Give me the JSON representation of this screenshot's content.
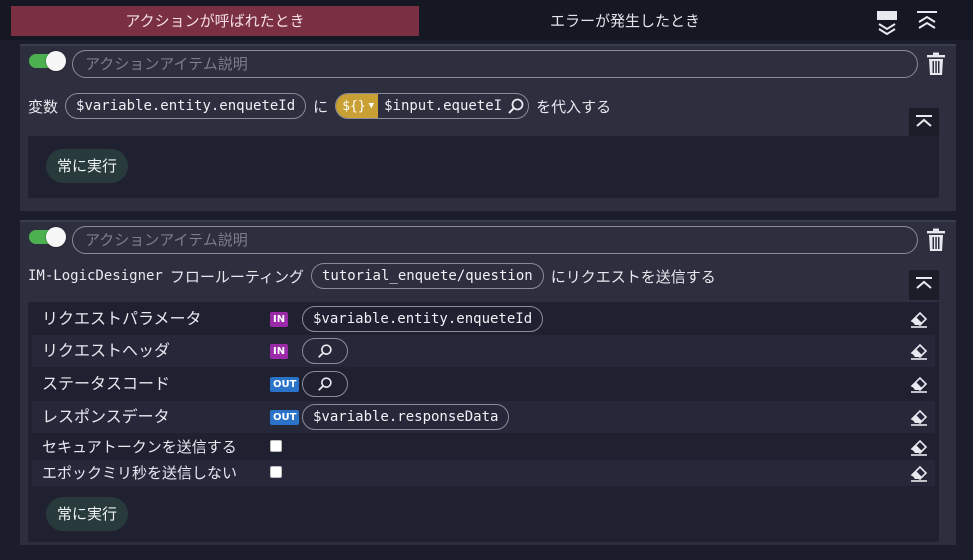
{
  "tabs": [
    {
      "label": "アクションが呼ばれたとき"
    },
    {
      "label": "エラーが発生したとき"
    }
  ],
  "action1": {
    "desc_placeholder": "アクションアイテム説明",
    "prefix": "変数",
    "variable": "$variable.entity.enqueteId",
    "particle": "に",
    "type_selector": "${}",
    "value": "$input.equeteI",
    "suffix": "を代入する",
    "run_label": "常に実行"
  },
  "action2": {
    "desc_placeholder": "アクションアイテム説明",
    "prefix": "IM-LogicDesigner",
    "routing_label": "フロールーティング",
    "flow": "tutorial_enquete/question",
    "suffix": "にリクエストを送信する",
    "params": [
      {
        "label": "リクエストパラメータ",
        "dir": "IN",
        "value": "$variable.entity.enqueteId"
      },
      {
        "label": "リクエストヘッダ",
        "dir": "IN",
        "value": ""
      },
      {
        "label": "ステータスコード",
        "dir": "OUT",
        "value": ""
      },
      {
        "label": "レスポンスデータ",
        "dir": "OUT",
        "value": "$variable.responseData"
      },
      {
        "label": "セキュアトークンを送信する"
      },
      {
        "label": "エポックミリ秒を送信しない"
      }
    ],
    "run_label": "常に実行"
  },
  "colors": {
    "active_tab": "#7a2f43",
    "toggle_on": "#4caf50",
    "selector": "#c8a033",
    "badge_in": "#9b2aa8",
    "badge_out": "#2a73c8"
  }
}
